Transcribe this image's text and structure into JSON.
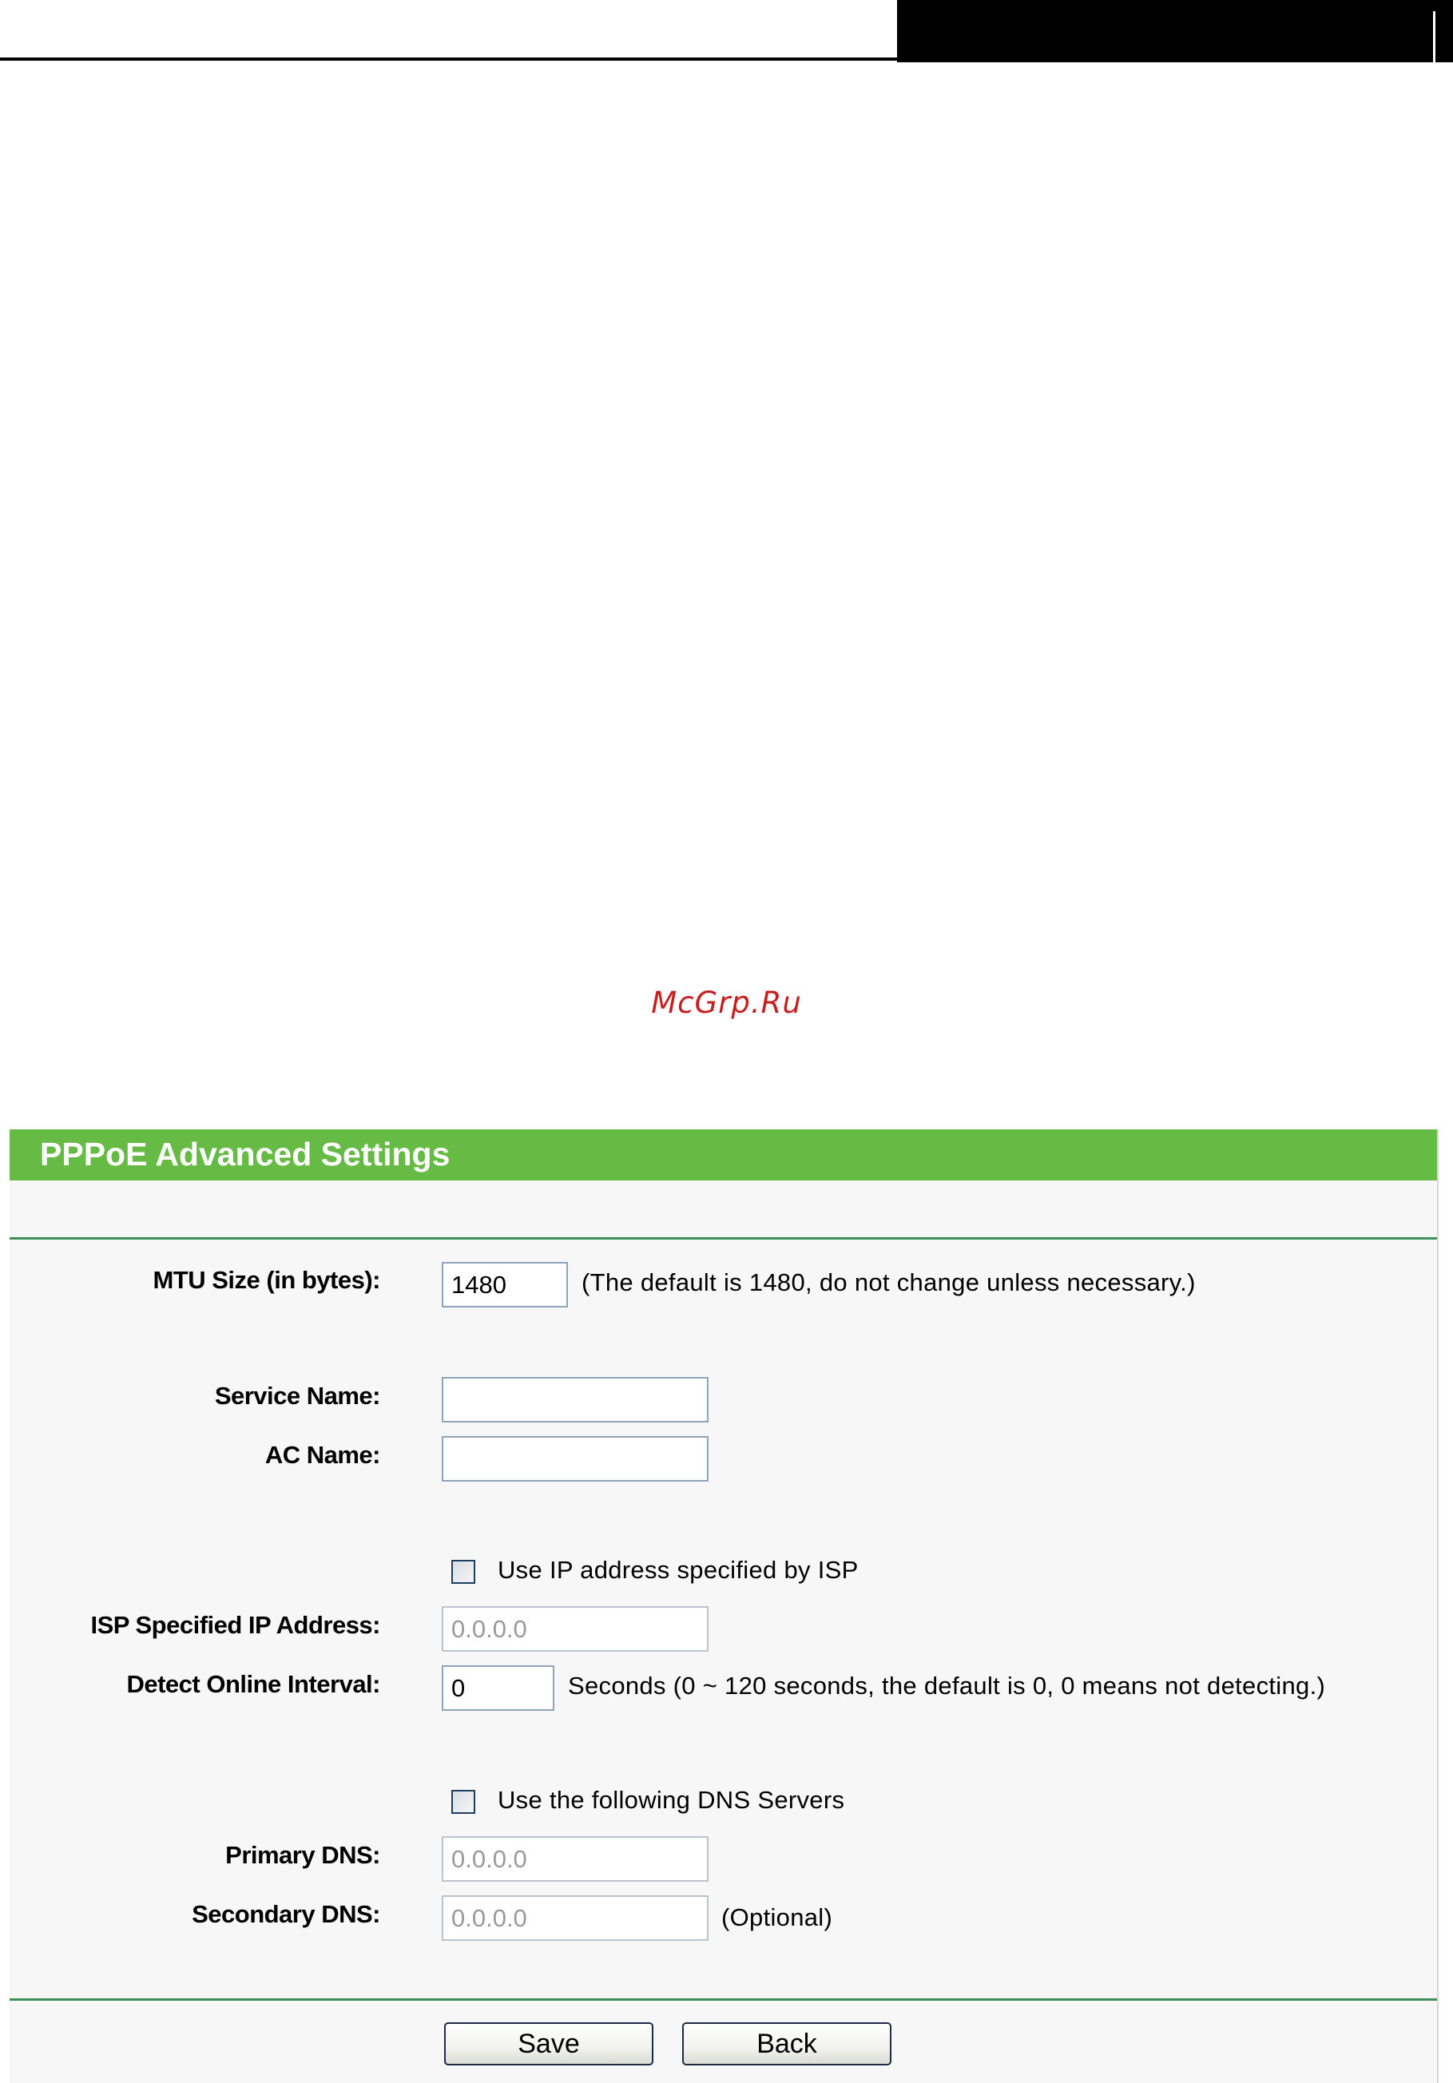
{
  "watermark": "McGrp.Ru",
  "panel": {
    "title": "PPPoE Advanced Settings"
  },
  "mtu": {
    "label": "MTU Size (in bytes):",
    "value": "1480",
    "note": "(The default is 1480, do not change unless necessary.)"
  },
  "service_name": {
    "label": "Service Name:",
    "value": ""
  },
  "ac_name": {
    "label": "AC Name:",
    "value": ""
  },
  "use_isp_ip": {
    "label": "Use IP address specified by ISP",
    "checked": false
  },
  "isp_ip": {
    "label": "ISP Specified IP Address:",
    "value": "0.0.0.0"
  },
  "detect_interval": {
    "label": "Detect Online Interval:",
    "value": "0",
    "note": "Seconds (0 ~ 120 seconds, the default is 0, 0 means not detecting.)"
  },
  "use_dns": {
    "label": "Use the following DNS Servers",
    "checked": false
  },
  "primary_dns": {
    "label": "Primary DNS:",
    "value": "0.0.0.0"
  },
  "secondary_dns": {
    "label": "Secondary DNS:",
    "value": "0.0.0.0",
    "note": "(Optional)"
  },
  "buttons": {
    "save": "Save",
    "back": "Back"
  },
  "colors": {
    "title_bar": "#66bb44",
    "divider": "#3f8f58",
    "watermark": "#c81e1e"
  }
}
